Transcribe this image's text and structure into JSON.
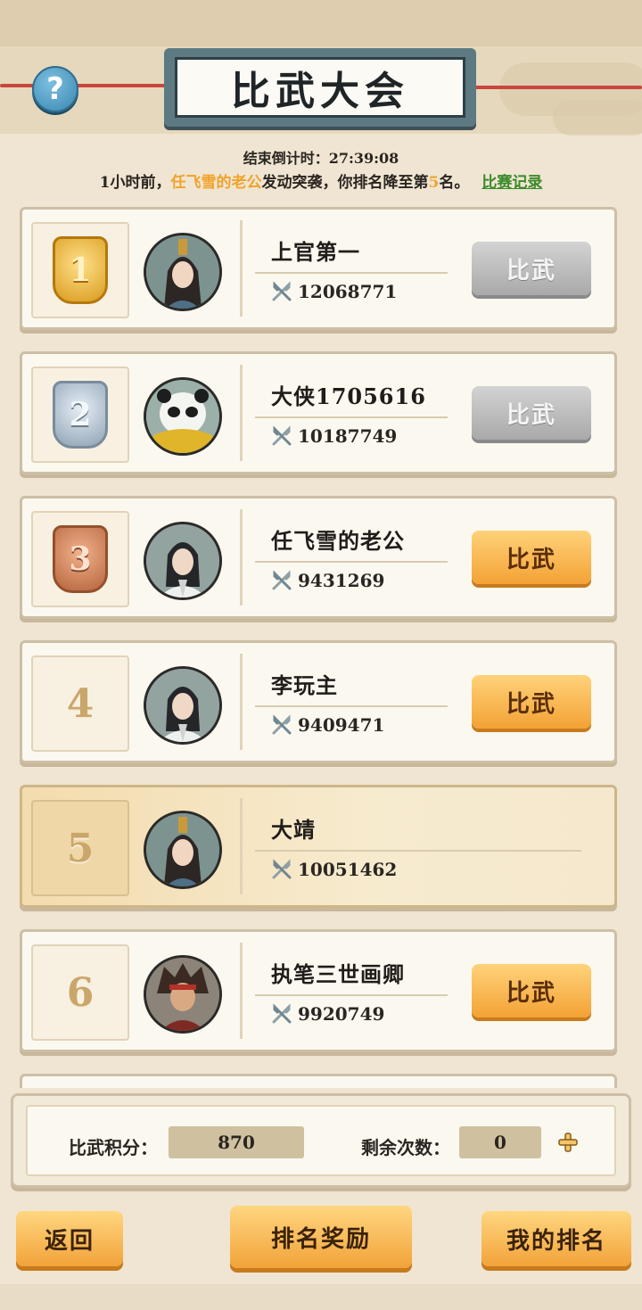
{
  "header": {
    "title": "比武大会",
    "help_label": "?",
    "countdown": "结束倒计时：27:39:08"
  },
  "news": {
    "prefix": "1小时前，",
    "attacker": "任飞雪的老公",
    "middle": "发动突袭，你排名降至第",
    "rank": "5",
    "suffix": "名。",
    "record_link": "比赛记录"
  },
  "rankings": [
    {
      "rank": "1",
      "medal": "gold",
      "name": "上官第一",
      "power": "12068771",
      "button": "比武",
      "button_enabled": false,
      "avatar": "long-hair-hero"
    },
    {
      "rank": "2",
      "medal": "silver",
      "name": "大侠1705616",
      "power": "10187749",
      "button": "比武",
      "button_enabled": false,
      "avatar": "panda"
    },
    {
      "rank": "3",
      "medal": "bronze",
      "name": "任飞雪的老公",
      "power": "9431269",
      "button": "比武",
      "button_enabled": true,
      "avatar": "white-robe-hero"
    },
    {
      "rank": "4",
      "medal": "",
      "name": "李玩主",
      "power": "9409471",
      "button": "比武",
      "button_enabled": true,
      "avatar": "white-robe-hero"
    },
    {
      "rank": "5",
      "medal": "",
      "name": "大靖",
      "power": "10051462",
      "button": "",
      "button_enabled": false,
      "avatar": "long-hair-hero",
      "is_self": true
    },
    {
      "rank": "6",
      "medal": "",
      "name": "执笔三世画卿",
      "power": "9920749",
      "button": "比武",
      "button_enabled": true,
      "avatar": "red-headband-warrior"
    }
  ],
  "stats": {
    "score_label": "比武积分：",
    "score_value": "870",
    "remaining_label": "剩余次数：",
    "remaining_value": "0"
  },
  "footer": {
    "back_label": "返回",
    "rewards_label": "排名奖励",
    "my_rank_label": "我的排名"
  },
  "colors": {
    "accent_orange": "#f3a235",
    "highlight_name": "#f0a32a",
    "link_green": "#3a8a2a",
    "disabled_gray": "#a9a9a9"
  }
}
